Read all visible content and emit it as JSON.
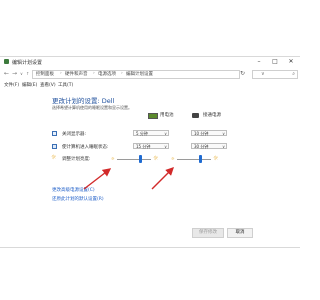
{
  "window": {
    "title": "编辑计划设置"
  },
  "address_bar": {
    "breadcrumbs": [
      "控制面板",
      "硬件和声音",
      "电源选项",
      "编辑计划设置"
    ],
    "search_placeholder": ""
  },
  "menu": [
    "文件(F)",
    "编辑(E)",
    "查看(V)",
    "工具(T)"
  ],
  "main": {
    "heading": "更改计划的设置: Dell",
    "description": "选择希望计算机使用的睡眠设置和显示设置。",
    "columns": {
      "on_battery": "用电池",
      "plugged_in": "接通电源"
    },
    "rows": [
      {
        "label": "关闭显示器:",
        "battery_value": "5 分钟",
        "plugged_value": "10 分钟"
      },
      {
        "label": "使计算机进入睡眠状态:",
        "battery_value": "15 分钟",
        "plugged_value": "30 分钟"
      }
    ],
    "brightness": {
      "label": "调整计划亮度:",
      "battery_level": 0.7,
      "plugged_level": 0.7
    },
    "links": [
      "更改高级电源设置(C)",
      "还原此计划的默认设置(R)"
    ]
  },
  "buttons": {
    "save": "保存修改",
    "cancel": "取消"
  },
  "colors": {
    "accent_link": "#1e5ec8",
    "heading": "#1e4f9c",
    "slider_thumb": "#1f6bd1",
    "annotation_arrow": "#d22a2a"
  }
}
